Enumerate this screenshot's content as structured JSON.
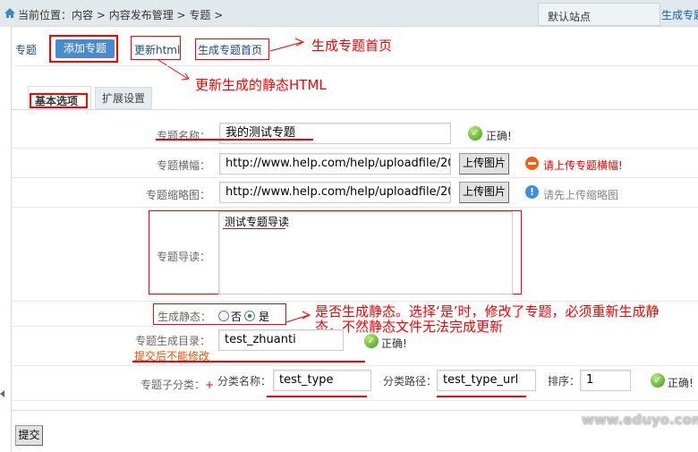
{
  "breadcrumb": {
    "prefix": "当前位置：",
    "items": [
      "内容",
      "内容发布管理",
      "专题"
    ],
    "sep": ">"
  },
  "site_select": "默认站点",
  "top_link": "生成专题首页",
  "toolbar": {
    "title": "专题",
    "add": "添加专题",
    "update_html": "更新html",
    "gen_index": "生成专题首页"
  },
  "annotations": {
    "gen_index": "生成专题首页",
    "update_html": "更新生成的静态HTML",
    "static": "是否生成静态。选择‘是’时，修改了专题，必须重新生成静态，不然静态文件无法完成更新",
    "dir_note": "提交后不能修改"
  },
  "tabs": [
    "基本选项",
    "扩展设置"
  ],
  "form": {
    "name": {
      "label": "专题名称：",
      "value": "我的测试专题",
      "status": "正确!"
    },
    "banner": {
      "label": "专题横幅：",
      "value": "http://www.help.com/help/uploadfile/20",
      "button": "上传图片",
      "status": "请上传专题横幅!"
    },
    "thumb": {
      "label": "专题缩略图：",
      "value": "http://www.help.com/help/uploadfile/20",
      "button": "上传图片",
      "status": "请先上传缩略图"
    },
    "guide": {
      "label": "专题导读：",
      "value": "测试专题导读"
    },
    "static": {
      "label": "生成静态：",
      "options": [
        "否",
        "是"
      ],
      "selected": "是"
    },
    "dir": {
      "label": "专题生成目录：",
      "value": "test_zhuanti",
      "status": "正确!"
    },
    "sub": {
      "label": "专题子分类：",
      "add": "+",
      "name_label": "分类名称：",
      "name": "test_type",
      "path_label": "分类路径：",
      "path": "test_type_url",
      "order_label": "排序：",
      "order": "1",
      "status": "正确!"
    }
  },
  "submit": "提交",
  "watermark": "www.eduyo.com"
}
